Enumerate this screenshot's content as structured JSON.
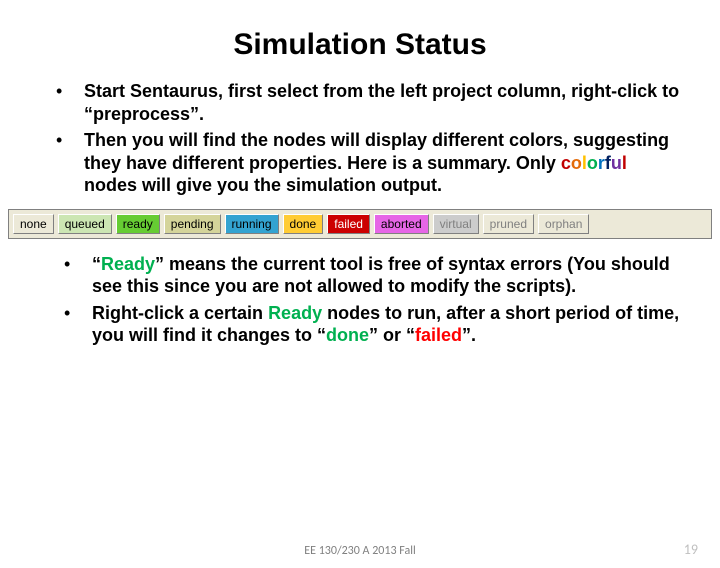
{
  "title": "Simulation Status",
  "bullets_top": {
    "b1": "Start Sentaurus, first select from the left project column, right-click to “preprocess”.",
    "b2_a": "Then you will find the nodes will display different colors, suggesting they have different properties. Here is a summary. Only ",
    "b2_b": " nodes will give you the simulation output."
  },
  "colorful": {
    "c1": "c",
    "c2": "o",
    "c3": "l",
    "c4": "o",
    "c5": "r",
    "c6": "f",
    "c7": "u",
    "c8": "l"
  },
  "status": [
    {
      "label": "none",
      "bg": "#ece9d8",
      "fg": "#000000"
    },
    {
      "label": "queued",
      "bg": "#cce6b3",
      "fg": "#000000"
    },
    {
      "label": "ready",
      "bg": "#66cc33",
      "fg": "#000000"
    },
    {
      "label": "pending",
      "bg": "#d4d49a",
      "fg": "#000000"
    },
    {
      "label": "running",
      "bg": "#33a3d1",
      "fg": "#000000"
    },
    {
      "label": "done",
      "bg": "#ffcc33",
      "fg": "#000000"
    },
    {
      "label": "failed",
      "bg": "#cc0000",
      "fg": "#ffffff"
    },
    {
      "label": "aborted",
      "bg": "#e666e6",
      "fg": "#000000"
    },
    {
      "label": "virtual",
      "bg": "#cccccc",
      "fg": "#808080"
    },
    {
      "label": "pruned",
      "bg": "#ece9d8",
      "fg": "#808080"
    },
    {
      "label": "orphan",
      "bg": "#ece9d8",
      "fg": "#808080"
    }
  ],
  "bullets_bottom": {
    "b1_q1": "“",
    "b1_ready": "Ready",
    "b1_q2": "”",
    "b1_rest": " means the current tool is free of syntax errors (You should see this since you are not allowed to modify the scripts).",
    "b2_a": "Right-click a certain ",
    "b2_ready": "Ready",
    "b2_b": " nodes to run, after a short period of time, you will find it changes to ",
    "b2_q1": "“",
    "b2_done": "done",
    "b2_q2": "”",
    "b2_or": " or ",
    "b2_q3": "“",
    "b2_failed": "failed",
    "b2_q4": "”."
  },
  "footer_center": "EE 130/230 A 2013 Fall",
  "footer_page": "19"
}
